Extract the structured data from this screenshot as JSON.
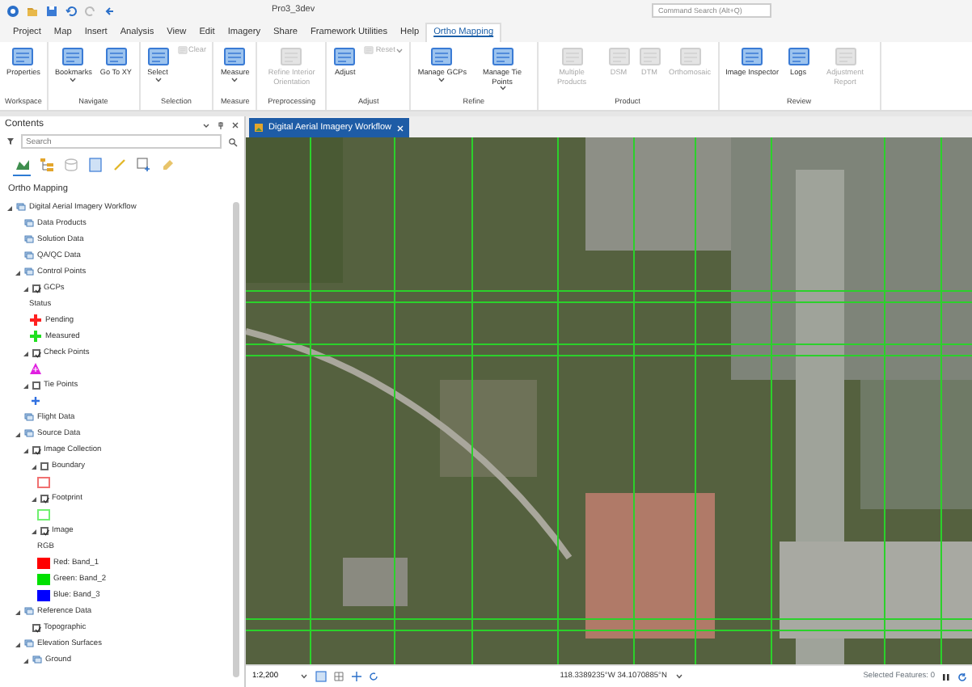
{
  "quick_access": {
    "project_title": "Pro3_3dev",
    "command_search": {
      "placeholder": "Command Search (Alt+Q)"
    }
  },
  "ribbon_tabs": [
    {
      "label": "Project",
      "selected": false
    },
    {
      "label": "Map",
      "selected": false
    },
    {
      "label": "Insert",
      "selected": false
    },
    {
      "label": "Analysis",
      "selected": false
    },
    {
      "label": "View",
      "selected": false
    },
    {
      "label": "Edit",
      "selected": false
    },
    {
      "label": "Imagery",
      "selected": false
    },
    {
      "label": "Share",
      "selected": false
    },
    {
      "label": "Framework Utilities",
      "selected": false
    },
    {
      "label": "Help",
      "selected": false
    },
    {
      "label": "Ortho Mapping",
      "selected": true
    }
  ],
  "ribbon_groups": [
    {
      "label": "Workspace",
      "tools": [
        {
          "kind": "large",
          "label": "Properties",
          "disabled": false,
          "dropdown": false
        }
      ]
    },
    {
      "label": "Navigate",
      "tools": [
        {
          "kind": "large",
          "label": "Bookmarks",
          "disabled": false,
          "dropdown": true
        },
        {
          "kind": "large",
          "label": "Go To XY",
          "disabled": false,
          "dropdown": false
        }
      ]
    },
    {
      "label": "Selection",
      "tools": [
        {
          "kind": "large",
          "label": "Select",
          "disabled": false,
          "dropdown": true
        },
        {
          "kind": "small",
          "label": "Clear",
          "disabled": true,
          "dropdown": false
        }
      ]
    },
    {
      "label": "Measure",
      "tools": [
        {
          "kind": "large",
          "label": "Measure",
          "disabled": false,
          "dropdown": true
        }
      ]
    },
    {
      "label": "Preprocessing",
      "tools": [
        {
          "kind": "large",
          "label": "Refine Interior Orientation",
          "disabled": true,
          "dropdown": false
        }
      ]
    },
    {
      "label": "Adjust",
      "tools": [
        {
          "kind": "large",
          "label": "Adjust",
          "disabled": false,
          "dropdown": false
        },
        {
          "kind": "small",
          "label": "Reset",
          "disabled": true,
          "dropdown": true
        }
      ]
    },
    {
      "label": "Refine",
      "tools": [
        {
          "kind": "large",
          "label": "Manage GCPs",
          "disabled": false,
          "dropdown": true
        },
        {
          "kind": "large",
          "label": "Manage Tie Points",
          "disabled": false,
          "dropdown": true
        }
      ]
    },
    {
      "label": "Product",
      "tools": [
        {
          "kind": "large",
          "label": "Multiple Products",
          "disabled": true,
          "dropdown": false
        },
        {
          "kind": "large",
          "label": "DSM",
          "disabled": true,
          "dropdown": false
        },
        {
          "kind": "large",
          "label": "DTM",
          "disabled": true,
          "dropdown": false
        },
        {
          "kind": "large",
          "label": "Orthomosaic",
          "disabled": true,
          "dropdown": false
        }
      ]
    },
    {
      "label": "Review",
      "tools": [
        {
          "kind": "large",
          "label": "Image Inspector",
          "disabled": false,
          "dropdown": false
        },
        {
          "kind": "large",
          "label": "Logs",
          "disabled": false,
          "dropdown": false
        },
        {
          "kind": "large",
          "label": "Adjustment Report",
          "disabled": true,
          "dropdown": false
        }
      ]
    }
  ],
  "contents": {
    "title": "Contents",
    "search": {
      "placeholder": "Search"
    },
    "view_buttons": [
      {
        "selected": true
      },
      {
        "selected": false
      },
      {
        "selected": false
      },
      {
        "selected": false
      },
      {
        "selected": false
      },
      {
        "selected": false
      },
      {
        "selected": false
      }
    ],
    "heading": "Ortho Mapping",
    "tree": [
      {
        "kind": "group",
        "label": "Digital Aerial Imagery Workflow",
        "expanded": true,
        "children": [
          {
            "kind": "group",
            "label": "Data Products"
          },
          {
            "kind": "group",
            "label": "Solution Data"
          },
          {
            "kind": "group",
            "label": "QA/QC Data"
          },
          {
            "kind": "group",
            "label": "Control Points",
            "expanded": true,
            "children": [
              {
                "kind": "layer",
                "label": "GCPs",
                "checked": true,
                "expanded": true,
                "children": [
                  {
                    "kind": "heading",
                    "label": "Status"
                  },
                  {
                    "kind": "cross",
                    "color": "#ff2020",
                    "label": "Pending"
                  },
                  {
                    "kind": "cross",
                    "color": "#20e020",
                    "label": "Measured"
                  }
                ]
              },
              {
                "kind": "layer",
                "label": "Check Points",
                "checked": true,
                "expanded": true,
                "children": [
                  {
                    "kind": "triangle",
                    "color": "#e020e0"
                  }
                ]
              },
              {
                "kind": "layer",
                "label": "Tie Points",
                "checked": false,
                "expanded": true,
                "children": [
                  {
                    "kind": "plus",
                    "color": "#3070e0"
                  }
                ]
              }
            ]
          },
          {
            "kind": "group",
            "label": "Flight Data"
          },
          {
            "kind": "group",
            "label": "Source Data",
            "expanded": true,
            "children": [
              {
                "kind": "layer",
                "label": "Image Collection",
                "checked": true,
                "expanded": true,
                "children": [
                  {
                    "kind": "layer",
                    "label": "Boundary",
                    "checked": false,
                    "expanded": true,
                    "children": [
                      {
                        "kind": "outline",
                        "color": "#f07070"
                      }
                    ]
                  },
                  {
                    "kind": "layer",
                    "label": "Footprint",
                    "checked": true,
                    "expanded": true,
                    "children": [
                      {
                        "kind": "outline",
                        "color": "#70f070"
                      }
                    ]
                  },
                  {
                    "kind": "layer",
                    "label": "Image",
                    "checked": true,
                    "expanded": true,
                    "children": [
                      {
                        "kind": "heading",
                        "label": "RGB"
                      },
                      {
                        "kind": "swatch",
                        "color": "#ff0000",
                        "label": "Red:  Band_1"
                      },
                      {
                        "kind": "swatch",
                        "color": "#00e000",
                        "label": "Green: Band_2"
                      },
                      {
                        "kind": "swatch",
                        "color": "#0000ff",
                        "label": "Blue:  Band_3"
                      }
                    ]
                  }
                ]
              }
            ]
          },
          {
            "kind": "group",
            "label": "Reference Data",
            "expanded": true,
            "children": [
              {
                "kind": "layer",
                "label": "Topographic",
                "checked": true
              }
            ]
          },
          {
            "kind": "group",
            "label": "Elevation Surfaces",
            "expanded": true,
            "children": [
              {
                "kind": "group",
                "label": "Ground",
                "expanded": true
              }
            ]
          }
        ]
      }
    ]
  },
  "map_view": {
    "tab": {
      "label": "Digital Aerial Imagery Workflow",
      "selected": true
    }
  },
  "status_bar": {
    "scale": "1:2,200",
    "coordinates": "118.3389235°W 34.1070885°N",
    "selected_features": "Selected Features: 0"
  }
}
